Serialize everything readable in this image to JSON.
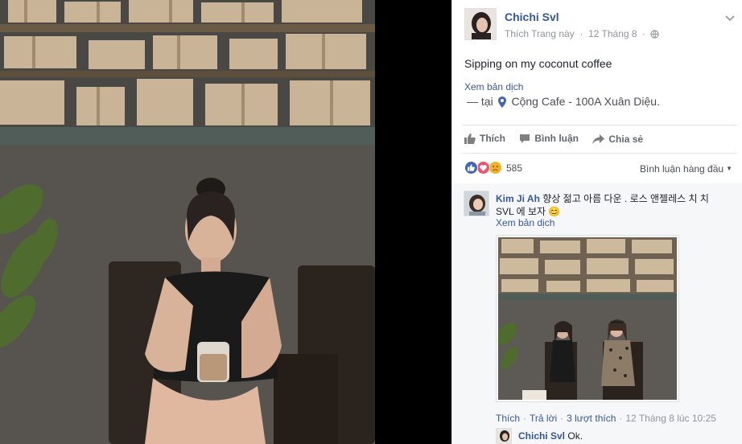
{
  "post": {
    "author": "Chichi Svl",
    "like_page": "Thích Trang này",
    "date": "12 Tháng 8",
    "dot": "·",
    "text": "Sipping on my coconut coffee",
    "translate": "Xem bản dịch",
    "checkin_prefix": "— tại",
    "location": "Cộng Cafe - 100A Xuân Diệu."
  },
  "actions": {
    "like": "Thích",
    "comment": "Bình luận",
    "share": "Chia sẻ"
  },
  "reactions": {
    "types": [
      "like-icon",
      "love-icon",
      "sad-icon"
    ],
    "count": "585",
    "sort_label": "Bình luận hàng đầu",
    "sort_caret": "▼"
  },
  "comments": [
    {
      "author": "Kim Ji Ah",
      "text": "향상 젊고 아름 다운 . 로스 앤젤레스 치 치 SVL 에 보자 😊",
      "translate": "Xem bản dịch",
      "like": "Thích",
      "reply": "Trả lời",
      "likes": "3 lượt thích",
      "time": "12 Tháng 8 lúc 10:25",
      "sep": "·"
    }
  ],
  "reply": {
    "author": "Chichi Svl",
    "text": "Ok."
  },
  "colors": {
    "link": "#365899",
    "muted": "#90949c",
    "like_blue": "#4267b2",
    "love_red": "#f25268",
    "sad_yellow": "#f7b125"
  }
}
